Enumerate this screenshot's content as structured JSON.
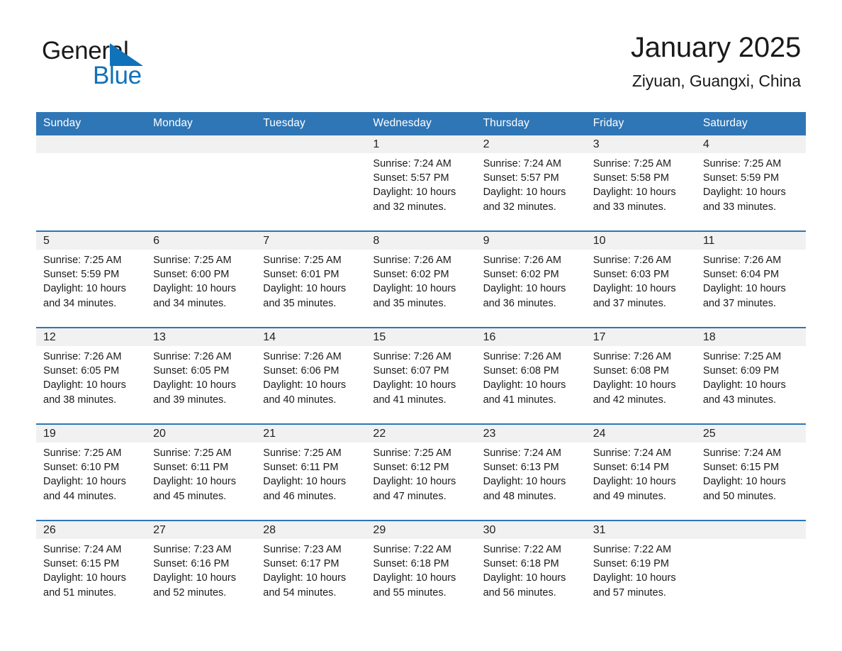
{
  "brand": {
    "name_part1": "General",
    "name_part2": "Blue",
    "accent_color": "#1072ba"
  },
  "header": {
    "title": "January 2025",
    "subtitle": "Ziyuan, Guangxi, China"
  },
  "theme": {
    "header_blue": "#2f76b6",
    "daynum_gray": "#f1f1f1",
    "text": "#1a1a1a"
  },
  "weekday_headers": [
    "Sunday",
    "Monday",
    "Tuesday",
    "Wednesday",
    "Thursday",
    "Friday",
    "Saturday"
  ],
  "weeks": [
    [
      {
        "day": ""
      },
      {
        "day": ""
      },
      {
        "day": ""
      },
      {
        "day": "1",
        "sunrise": "Sunrise: 7:24 AM",
        "sunset": "Sunset: 5:57 PM",
        "daylight_1": "Daylight: 10 hours",
        "daylight_2": "and 32 minutes."
      },
      {
        "day": "2",
        "sunrise": "Sunrise: 7:24 AM",
        "sunset": "Sunset: 5:57 PM",
        "daylight_1": "Daylight: 10 hours",
        "daylight_2": "and 32 minutes."
      },
      {
        "day": "3",
        "sunrise": "Sunrise: 7:25 AM",
        "sunset": "Sunset: 5:58 PM",
        "daylight_1": "Daylight: 10 hours",
        "daylight_2": "and 33 minutes."
      },
      {
        "day": "4",
        "sunrise": "Sunrise: 7:25 AM",
        "sunset": "Sunset: 5:59 PM",
        "daylight_1": "Daylight: 10 hours",
        "daylight_2": "and 33 minutes."
      }
    ],
    [
      {
        "day": "5",
        "sunrise": "Sunrise: 7:25 AM",
        "sunset": "Sunset: 5:59 PM",
        "daylight_1": "Daylight: 10 hours",
        "daylight_2": "and 34 minutes."
      },
      {
        "day": "6",
        "sunrise": "Sunrise: 7:25 AM",
        "sunset": "Sunset: 6:00 PM",
        "daylight_1": "Daylight: 10 hours",
        "daylight_2": "and 34 minutes."
      },
      {
        "day": "7",
        "sunrise": "Sunrise: 7:25 AM",
        "sunset": "Sunset: 6:01 PM",
        "daylight_1": "Daylight: 10 hours",
        "daylight_2": "and 35 minutes."
      },
      {
        "day": "8",
        "sunrise": "Sunrise: 7:26 AM",
        "sunset": "Sunset: 6:02 PM",
        "daylight_1": "Daylight: 10 hours",
        "daylight_2": "and 35 minutes."
      },
      {
        "day": "9",
        "sunrise": "Sunrise: 7:26 AM",
        "sunset": "Sunset: 6:02 PM",
        "daylight_1": "Daylight: 10 hours",
        "daylight_2": "and 36 minutes."
      },
      {
        "day": "10",
        "sunrise": "Sunrise: 7:26 AM",
        "sunset": "Sunset: 6:03 PM",
        "daylight_1": "Daylight: 10 hours",
        "daylight_2": "and 37 minutes."
      },
      {
        "day": "11",
        "sunrise": "Sunrise: 7:26 AM",
        "sunset": "Sunset: 6:04 PM",
        "daylight_1": "Daylight: 10 hours",
        "daylight_2": "and 37 minutes."
      }
    ],
    [
      {
        "day": "12",
        "sunrise": "Sunrise: 7:26 AM",
        "sunset": "Sunset: 6:05 PM",
        "daylight_1": "Daylight: 10 hours",
        "daylight_2": "and 38 minutes."
      },
      {
        "day": "13",
        "sunrise": "Sunrise: 7:26 AM",
        "sunset": "Sunset: 6:05 PM",
        "daylight_1": "Daylight: 10 hours",
        "daylight_2": "and 39 minutes."
      },
      {
        "day": "14",
        "sunrise": "Sunrise: 7:26 AM",
        "sunset": "Sunset: 6:06 PM",
        "daylight_1": "Daylight: 10 hours",
        "daylight_2": "and 40 minutes."
      },
      {
        "day": "15",
        "sunrise": "Sunrise: 7:26 AM",
        "sunset": "Sunset: 6:07 PM",
        "daylight_1": "Daylight: 10 hours",
        "daylight_2": "and 41 minutes."
      },
      {
        "day": "16",
        "sunrise": "Sunrise: 7:26 AM",
        "sunset": "Sunset: 6:08 PM",
        "daylight_1": "Daylight: 10 hours",
        "daylight_2": "and 41 minutes."
      },
      {
        "day": "17",
        "sunrise": "Sunrise: 7:26 AM",
        "sunset": "Sunset: 6:08 PM",
        "daylight_1": "Daylight: 10 hours",
        "daylight_2": "and 42 minutes."
      },
      {
        "day": "18",
        "sunrise": "Sunrise: 7:25 AM",
        "sunset": "Sunset: 6:09 PM",
        "daylight_1": "Daylight: 10 hours",
        "daylight_2": "and 43 minutes."
      }
    ],
    [
      {
        "day": "19",
        "sunrise": "Sunrise: 7:25 AM",
        "sunset": "Sunset: 6:10 PM",
        "daylight_1": "Daylight: 10 hours",
        "daylight_2": "and 44 minutes."
      },
      {
        "day": "20",
        "sunrise": "Sunrise: 7:25 AM",
        "sunset": "Sunset: 6:11 PM",
        "daylight_1": "Daylight: 10 hours",
        "daylight_2": "and 45 minutes."
      },
      {
        "day": "21",
        "sunrise": "Sunrise: 7:25 AM",
        "sunset": "Sunset: 6:11 PM",
        "daylight_1": "Daylight: 10 hours",
        "daylight_2": "and 46 minutes."
      },
      {
        "day": "22",
        "sunrise": "Sunrise: 7:25 AM",
        "sunset": "Sunset: 6:12 PM",
        "daylight_1": "Daylight: 10 hours",
        "daylight_2": "and 47 minutes."
      },
      {
        "day": "23",
        "sunrise": "Sunrise: 7:24 AM",
        "sunset": "Sunset: 6:13 PM",
        "daylight_1": "Daylight: 10 hours",
        "daylight_2": "and 48 minutes."
      },
      {
        "day": "24",
        "sunrise": "Sunrise: 7:24 AM",
        "sunset": "Sunset: 6:14 PM",
        "daylight_1": "Daylight: 10 hours",
        "daylight_2": "and 49 minutes."
      },
      {
        "day": "25",
        "sunrise": "Sunrise: 7:24 AM",
        "sunset": "Sunset: 6:15 PM",
        "daylight_1": "Daylight: 10 hours",
        "daylight_2": "and 50 minutes."
      }
    ],
    [
      {
        "day": "26",
        "sunrise": "Sunrise: 7:24 AM",
        "sunset": "Sunset: 6:15 PM",
        "daylight_1": "Daylight: 10 hours",
        "daylight_2": "and 51 minutes."
      },
      {
        "day": "27",
        "sunrise": "Sunrise: 7:23 AM",
        "sunset": "Sunset: 6:16 PM",
        "daylight_1": "Daylight: 10 hours",
        "daylight_2": "and 52 minutes."
      },
      {
        "day": "28",
        "sunrise": "Sunrise: 7:23 AM",
        "sunset": "Sunset: 6:17 PM",
        "daylight_1": "Daylight: 10 hours",
        "daylight_2": "and 54 minutes."
      },
      {
        "day": "29",
        "sunrise": "Sunrise: 7:22 AM",
        "sunset": "Sunset: 6:18 PM",
        "daylight_1": "Daylight: 10 hours",
        "daylight_2": "and 55 minutes."
      },
      {
        "day": "30",
        "sunrise": "Sunrise: 7:22 AM",
        "sunset": "Sunset: 6:18 PM",
        "daylight_1": "Daylight: 10 hours",
        "daylight_2": "and 56 minutes."
      },
      {
        "day": "31",
        "sunrise": "Sunrise: 7:22 AM",
        "sunset": "Sunset: 6:19 PM",
        "daylight_1": "Daylight: 10 hours",
        "daylight_2": "and 57 minutes."
      },
      {
        "day": ""
      }
    ]
  ]
}
